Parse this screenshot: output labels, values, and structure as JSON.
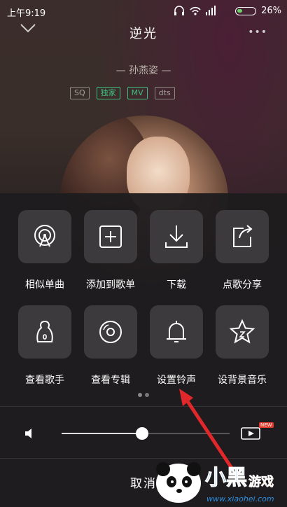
{
  "status": {
    "time": "上午9:19",
    "battery": "26%"
  },
  "header": {
    "title": "逆光",
    "more": "•••"
  },
  "song": {
    "artist": "— 孙燕姿 —",
    "badges": [
      "SQ",
      "独家",
      "MV",
      "dts"
    ]
  },
  "menu": {
    "row1": [
      "相似单曲",
      "添加到歌单",
      "下载",
      "点歌分享"
    ],
    "row2": [
      "查看歌手",
      "查看专辑",
      "设置铃声",
      "设背景音乐"
    ]
  },
  "player": {
    "volume": 0.48,
    "new_badge": "NEW"
  },
  "footer": {
    "cancel": "取消"
  },
  "watermark": {
    "text": "小黑游戏",
    "url": "www.xiaohei.com"
  },
  "colors": {
    "accent_green": "#3fbf7f",
    "arrow_red": "#e0282a",
    "battery_green": "#6cd36c"
  }
}
